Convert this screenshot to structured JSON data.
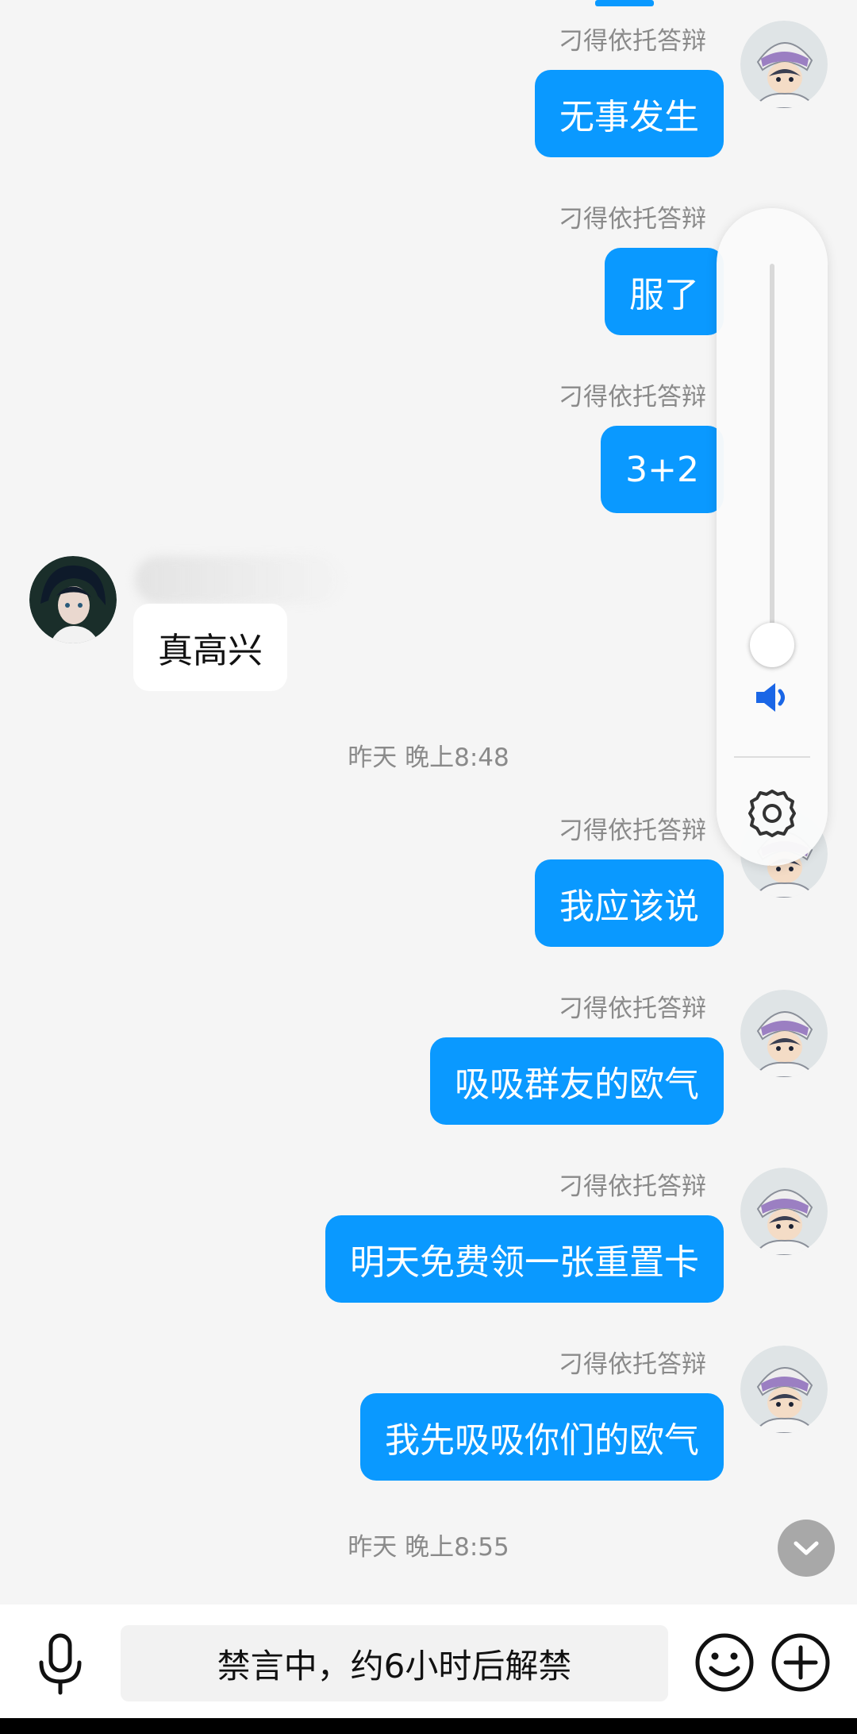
{
  "messages": [
    {
      "sender": "刁得依托答辩",
      "text": "无事发生"
    },
    {
      "sender": "刁得依托答辩",
      "text": "服了"
    },
    {
      "sender": "刁得依托答辩",
      "text": "3+2"
    },
    {
      "sender": "",
      "text": "真高兴"
    },
    {
      "sender": "刁得依托答辩",
      "text": "我应该说"
    },
    {
      "sender": "刁得依托答辩",
      "text": "吸吸群友的欧气"
    },
    {
      "sender": "刁得依托答辩",
      "text": "明天免费领一张重置卡"
    },
    {
      "sender": "刁得依托答辩",
      "text": "我先吸吸你们的欧气"
    }
  ],
  "timestamps": [
    "昨天 晚上8:48",
    "昨天 晚上8:55"
  ],
  "volume": {
    "level_fraction": 0.04
  },
  "input": {
    "mute_notice": "禁言中，约6小时后解禁"
  },
  "colors": {
    "bubble_out": "#0a99ff",
    "bubble_in": "#ffffff",
    "accent": "#1a66e6",
    "background": "#f5f5f5"
  },
  "icons": [
    "microphone-icon",
    "emoji-icon",
    "plus-icon",
    "speaker-icon",
    "gear-icon",
    "chevron-down-icon"
  ]
}
